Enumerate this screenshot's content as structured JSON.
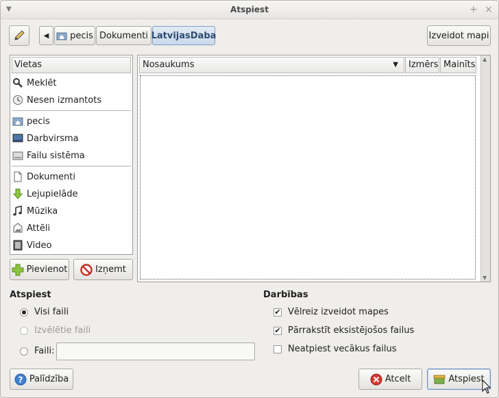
{
  "window": {
    "title": "Atspiest"
  },
  "toolbar": {
    "path": [
      "pecis",
      "Dokumenti",
      "LatvijasDaba"
    ],
    "create_folder_label": "Izveidot mapi"
  },
  "places": {
    "header": "Vietas",
    "groups": [
      [
        {
          "label": "Meklēt",
          "icon": "search-icon"
        },
        {
          "label": "Nesen izmantots",
          "icon": "recent-icon"
        }
      ],
      [
        {
          "label": "pecis",
          "icon": "home-folder-icon"
        },
        {
          "label": "Darbvirsma",
          "icon": "desktop-icon"
        },
        {
          "label": "Failu sistēma",
          "icon": "drive-icon"
        }
      ],
      [
        {
          "label": "Dokumenti",
          "icon": "document-icon"
        },
        {
          "label": "Lejupielāde",
          "icon": "download-icon"
        },
        {
          "label": "Mūzika",
          "icon": "music-icon"
        },
        {
          "label": "Attēli",
          "icon": "pictures-icon"
        },
        {
          "label": "Video",
          "icon": "video-icon"
        }
      ]
    ],
    "add_label": "Pievienot",
    "remove_label": "Izņemt"
  },
  "filelist": {
    "columns": [
      "Nosaukums",
      "Izmērs",
      "Mainīts"
    ]
  },
  "extract": {
    "title": "Atspiest",
    "options": [
      "Visi faili",
      "Izvēlētie faili",
      "Faili:"
    ],
    "selected": "Visi faili",
    "files_value": ""
  },
  "actions": {
    "title": "Darbības",
    "checks": [
      {
        "label": "Vēlreiz izveidot mapes",
        "checked": true
      },
      {
        "label": "Pārrakstīt eksistējošos failus",
        "checked": true
      },
      {
        "label": "Neatpiest vecākus failus",
        "checked": false
      }
    ]
  },
  "buttons": {
    "help": "Palīdzība",
    "cancel": "Atcelt",
    "extract": "Atspiest"
  },
  "colors": {
    "active_crumb": "#c9d8ea",
    "cancel_icon": "#d23a33",
    "help_icon": "#3f7fd0"
  }
}
